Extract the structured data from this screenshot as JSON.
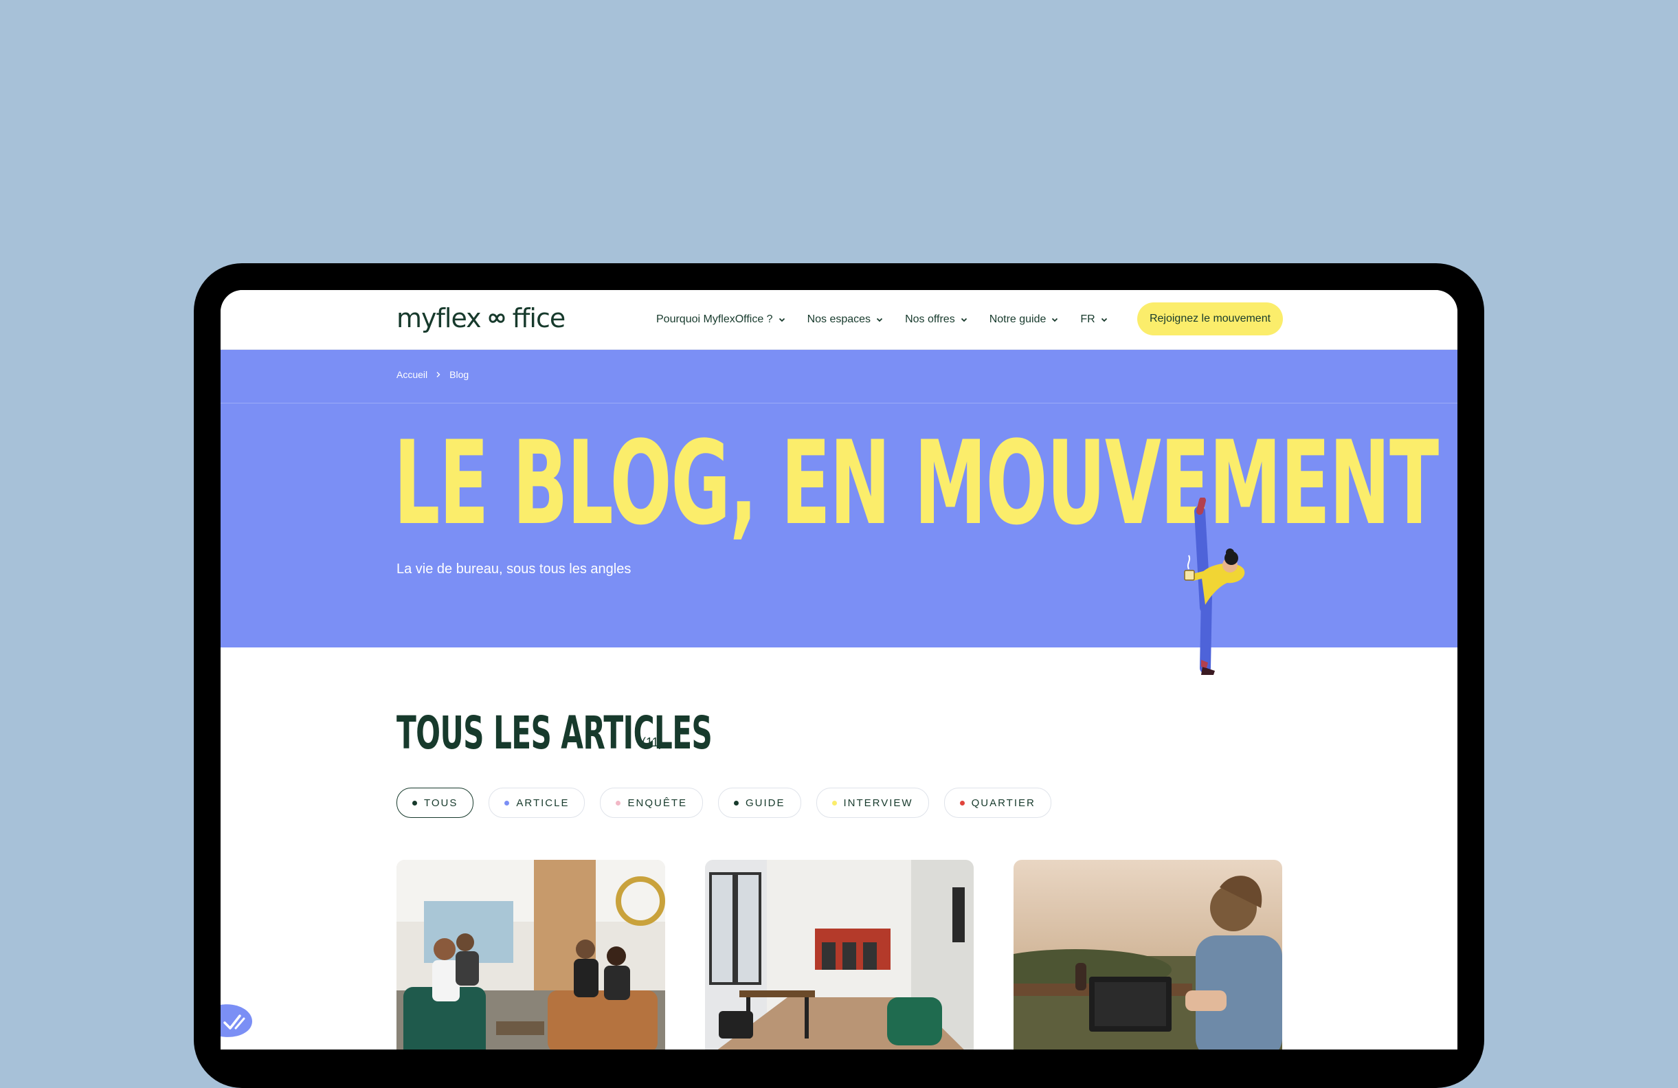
{
  "header": {
    "logo_text": "myflexoffice",
    "nav": [
      {
        "label": "Pourquoi MyflexOffice ?"
      },
      {
        "label": "Nos espaces"
      },
      {
        "label": "Nos offres"
      },
      {
        "label": "Notre guide"
      },
      {
        "label": "FR"
      }
    ],
    "cta_label": "Rejoignez le mouvement"
  },
  "breadcrumb": {
    "items": [
      "Accueil",
      "Blog"
    ]
  },
  "hero": {
    "title": "LE BLOG, EN MOUVEMENT",
    "subtitle": "La vie de bureau, sous tous les angles"
  },
  "articles": {
    "title": "TOUS LES ARTICLES",
    "count": "(11)",
    "filters": [
      {
        "label": "TOUS",
        "dot_color": "#173a2c",
        "active": true
      },
      {
        "label": "ARTICLE",
        "dot_color": "#7b8ff5",
        "active": false
      },
      {
        "label": "ENQUÊTE",
        "dot_color": "#f2b8c6",
        "active": false
      },
      {
        "label": "GUIDE",
        "dot_color": "#173a2c",
        "active": false
      },
      {
        "label": "INTERVIEW",
        "dot_color": "#fbed6b",
        "active": false
      },
      {
        "label": "QUARTIER",
        "dot_color": "#e0443c",
        "active": false
      }
    ]
  },
  "colors": {
    "background": "#a7c1d8",
    "hero": "#7b8ff5",
    "accent_yellow": "#fbed6b",
    "brand_green": "#173a2c"
  },
  "icons": {
    "nav_chevron": "chevron-down-icon",
    "breadcrumb_sep": "chevron-right-icon",
    "corner_badge": "check-badge-icon"
  }
}
